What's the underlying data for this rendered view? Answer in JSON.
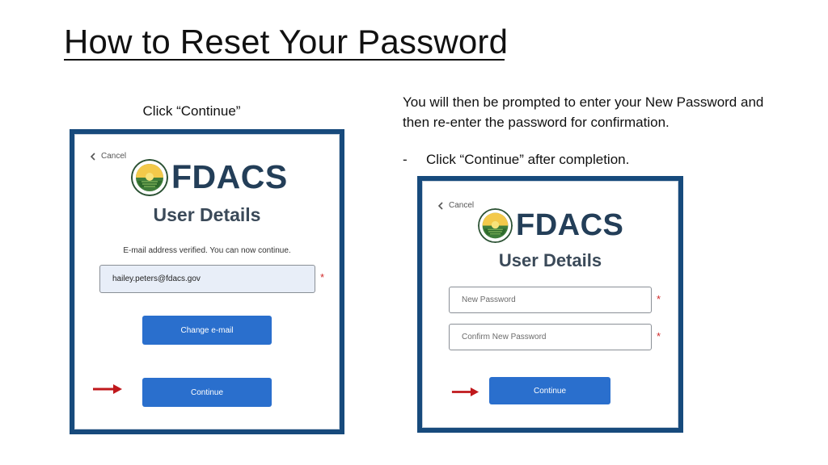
{
  "slide": {
    "title": "How to Reset Your Password",
    "left_caption": "Click “Continue”",
    "right_caption": "You will then be prompted to enter your New Password and then re-enter the password for confirmation.",
    "bullet_marker": "-",
    "bullet": "Click “Continue” after completion."
  },
  "left_screen": {
    "cancel_label": "Cancel",
    "logo_text": "FDACS",
    "heading": "User Details",
    "verify_note": "E-mail address verified. You can now continue.",
    "email_value": "hailey.peters@fdacs.gov",
    "required_mark": "*",
    "change_email_label": "Change e-mail",
    "continue_label": "Continue"
  },
  "right_screen": {
    "cancel_label": "Cancel",
    "logo_text": "FDACS",
    "heading": "User Details",
    "new_password_placeholder": "New Password",
    "confirm_password_placeholder": "Confirm New Password",
    "required_mark": "*",
    "continue_label": "Continue"
  },
  "colors": {
    "frame": "#174a7c",
    "button": "#2a6fcd",
    "arrow": "#c0181c",
    "required": "#d12a2a"
  }
}
